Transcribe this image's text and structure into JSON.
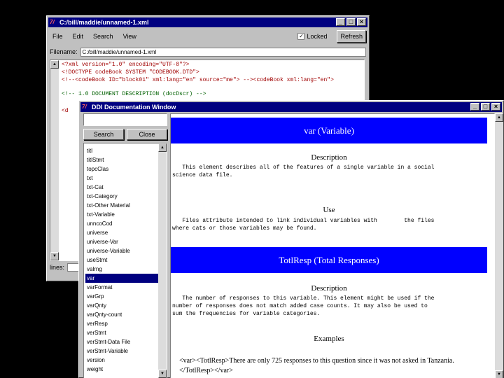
{
  "editor": {
    "title": "C:/bill/maddie/unnamed-1.xml",
    "menu": [
      "File",
      "Edit",
      "Search",
      "View"
    ],
    "locked_label": "Locked",
    "locked_checked": true,
    "refresh_label": "Refresh",
    "filename_label": "Filename:",
    "filename_value": "C:/bill/maddie/unnamed-1.xml",
    "code_lines": [
      "<?xml version=\"1.0\" encoding=\"UTF-8\"?>",
      "<!DOCTYPE codeBook SYSTEM \"CODEBOOK.DTD\">",
      "<!--<codeBook ID=\"block01\" xml:lang=\"en\" source=\"me\"> --><codeBook xml:lang=\"en\">",
      "<!-- 1.0 DOCUMENT DESCRIPTION (docDscr) -->",
      "<d"
    ],
    "lines_label": "lines:"
  },
  "ddi": {
    "title": "DDI Documentation Window",
    "search_label": "Search",
    "close_label": "Close",
    "list_items": [
      "titl",
      "titlStmt",
      "topcClas",
      "txt",
      "txt-Cat",
      "txt-Category",
      "txt-Other Material",
      "txt-Variable",
      "unncoCod",
      "universe",
      "universe-Var",
      "universe-Variable",
      "useStmt",
      "valrng",
      "var",
      "varFormat",
      "varGrp",
      "varQnty",
      "varQnty-count",
      "verResp",
      "verStmt",
      "verStmt-Data File",
      "verStmt-Variable",
      "version",
      "weight"
    ],
    "selected_item": "var",
    "sections": [
      {
        "banner": "var   (Variable)",
        "blocks": [
          {
            "heading": "Description",
            "text": "   This element describes all of the features of a single variable in a social\nscience data file."
          },
          {
            "heading": "Use",
            "text": "   Files attribute intended to link individual variables with        the files\nwhere cats or those variables may be found."
          }
        ]
      },
      {
        "banner": "TotlResp   (Total Responses)",
        "blocks": [
          {
            "heading": "Description",
            "text": "   The number of responses to this variable. This element might be used if the\nnumber of responses does not match added case counts. It may also be used to\nsum the frequencies for variable categories."
          },
          {
            "heading": "Examples",
            "text": "<var><TotlResp>There are only 725 responses to this question since it was not asked in\nTanzania.</TotlResp></var>"
          }
        ]
      }
    ]
  }
}
